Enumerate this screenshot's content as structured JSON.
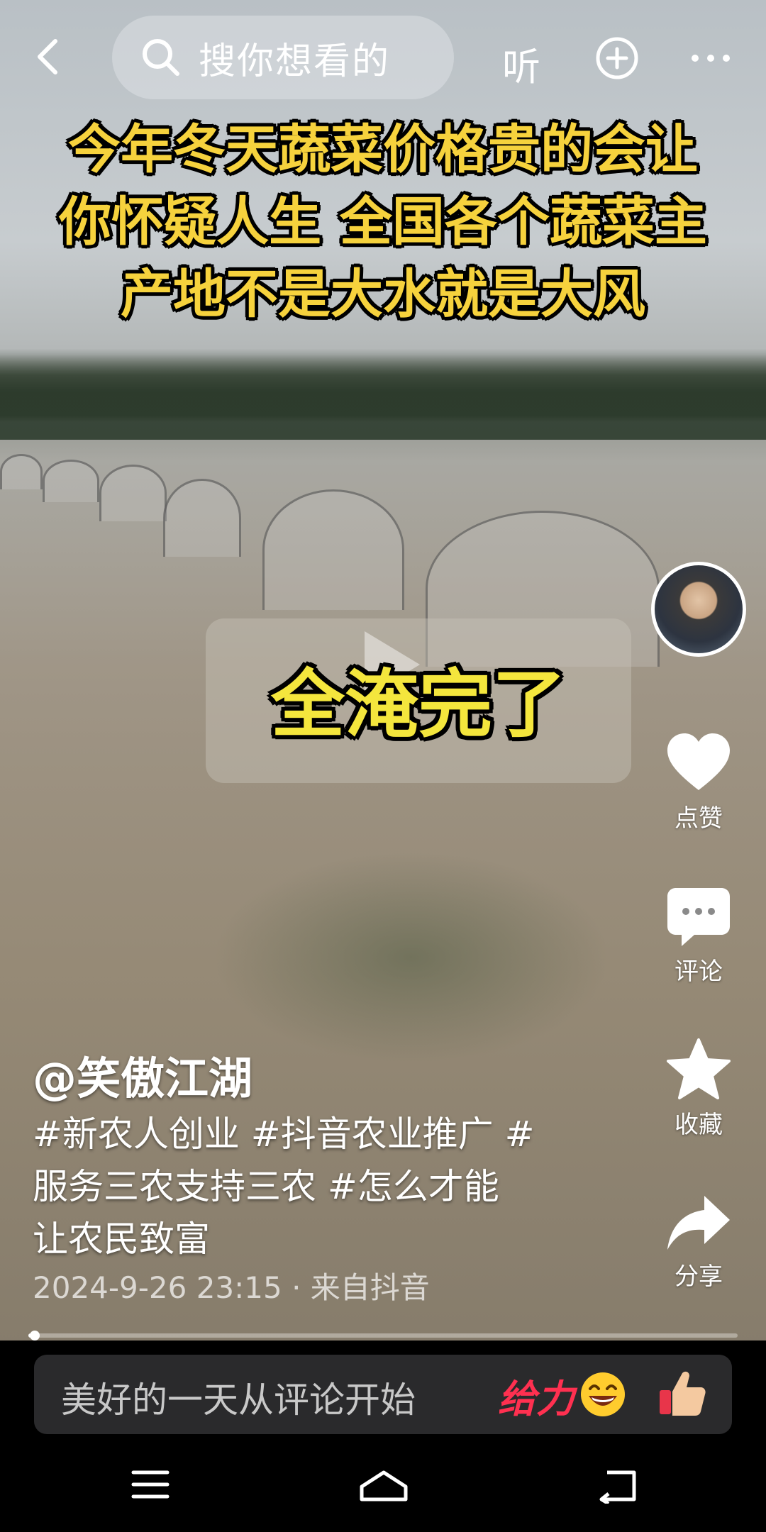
{
  "search": {
    "placeholder": "搜你想看的",
    "listen_label": "听"
  },
  "video": {
    "headline_lines": [
      "今年冬天蔬菜价格贵的会让",
      "你怀疑人生 全国各个蔬菜主",
      "产地不是大水就是大风"
    ],
    "center_caption": "全淹完了",
    "progress": 0.01
  },
  "actions": {
    "like_label": "点赞",
    "comment_label": "评论",
    "favorite_label": "收藏",
    "share_label": "分享"
  },
  "post": {
    "author": "@笑傲江湖",
    "description_lines": [
      "#新农人创业 #抖音农业推广 #",
      "服务三农支持三农 #怎么才能",
      "让农民致富"
    ],
    "meta": "2024-9-26 23:15 · 来自抖音"
  },
  "comment_bar": {
    "placeholder": "美好的一天从评论开始",
    "gift_label": "给力"
  },
  "colors": {
    "headline": "#f6d23d",
    "caption": "#f4e63d",
    "gift": "#ff3050",
    "like_heart": "#ffffff"
  },
  "icons": [
    "back-arrow-icon",
    "search-icon",
    "plus-circle-icon",
    "more-dots-icon",
    "play-icon",
    "heart-icon",
    "comment-bubble-icon",
    "star-icon",
    "share-arrow-icon",
    "laugh-emoji-icon",
    "thumbs-up-icon",
    "menu-icon",
    "home-icon",
    "back-nav-icon"
  ]
}
